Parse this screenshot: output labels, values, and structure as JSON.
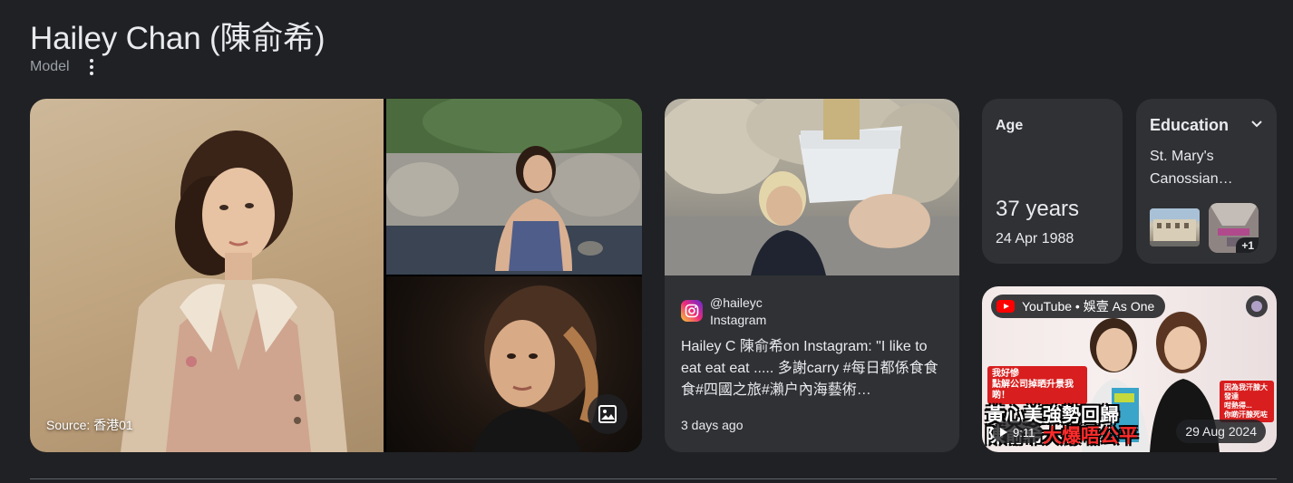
{
  "header": {
    "title": "Hailey Chan (陳俞希)",
    "subtitle": "Model"
  },
  "images": {
    "source_label": "Source: 香港01"
  },
  "instagram": {
    "handle": "@haileyc",
    "site": "Instagram",
    "text": "Hailey C 陳俞希on Instagram: \"I like to eat eat eat ..... 多謝carry #每日都係食食食#四國之旅#瀨户內海藝術…",
    "time": "3 days ago"
  },
  "age": {
    "label": "Age",
    "value": "37 years",
    "birth_date": "24 Apr 1988"
  },
  "education": {
    "label": "Education",
    "school": "St. Mary's Canossian…",
    "more_count": "+1"
  },
  "youtube": {
    "source": "YouTube • 娛壹 As One",
    "duration": "9:11",
    "date": "29 Aug 2024",
    "caption_line1": "黃心美強勢回歸",
    "caption_line2a": "陳俞希",
    "caption_line2b": "大爆唔公平",
    "bubble_left": "我好慘\n點解公司掉晒升景我啲！",
    "bubble_right": "因為我汗腺大發達\n咁熱得...\n你啲汗腺死咗"
  },
  "colors": {
    "background": "#202124",
    "card": "#303134",
    "text": "#e8eaed",
    "muted": "#9aa0a6",
    "youtube_red": "#ff0000"
  }
}
